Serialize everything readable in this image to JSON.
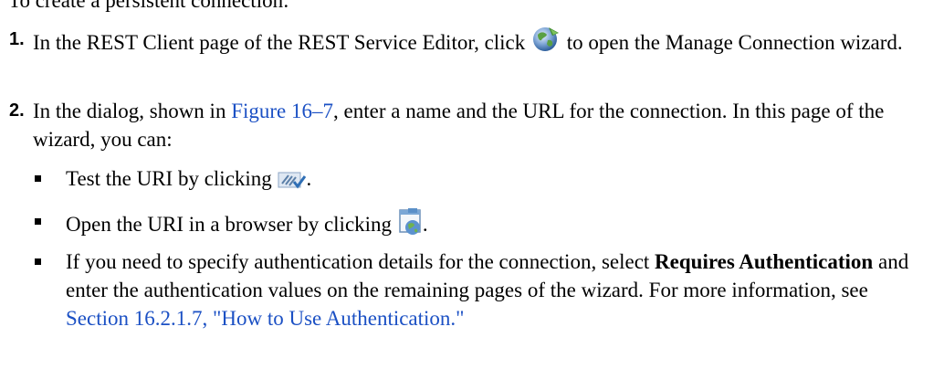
{
  "intro": "To create a persistent connection:",
  "steps": [
    {
      "num": "1.",
      "text_a": "In the REST Client page of the REST Service Editor, click",
      "text_b": "to open the Manage Connection wizard."
    },
    {
      "num": "2.",
      "text_a": "In the dialog, shown in",
      "link": "Figure 16–7",
      "text_b": ", enter a name and the URL for the connection. In this page of the wizard, you can:"
    }
  ],
  "bullets": [
    {
      "text_a": "Test the URI by clicking",
      "text_b": "."
    },
    {
      "text_a": "Open the URI in a browser by clicking",
      "text_b": "."
    },
    {
      "text_a": "If you need to specify authentication details for the connection, select",
      "bold": "Requires Authentication",
      "text_b": "and enter the authentication values on the remaining pages of the wizard. For more information, see",
      "link": "Section 16.2.1.7, \"How to Use Authentication.\""
    }
  ],
  "icons": {
    "manage_connection": "globe-connection-icon",
    "test_uri": "test-uri-check-icon",
    "open_browser": "browser-window-globe-icon"
  },
  "colors": {
    "link": "#1b50c4",
    "text": "#000000"
  }
}
